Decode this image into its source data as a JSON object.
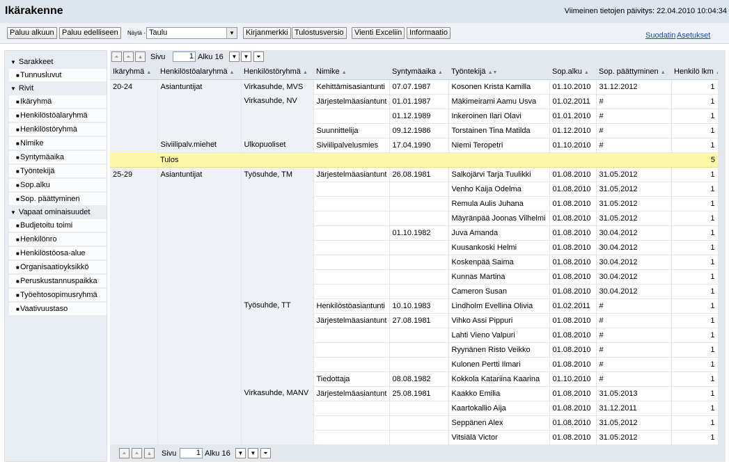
{
  "header": {
    "title": "Ikärakenne",
    "last_update": "Viimeinen tietojen päivitys: 22.04.2010 10:04:34"
  },
  "toolbar": {
    "back_home": "Paluu alkuun",
    "back_prev": "Paluu edelliseen",
    "view_label": "Näytä -",
    "view_value": "Taulu",
    "bookmark": "Kirjanmerkki",
    "print": "Tulostusversio",
    "excel": "Vienti Exceliin",
    "info": "Informaatio",
    "filter": "Suodatin",
    "settings": "Asetukset"
  },
  "sidebar": {
    "sections": [
      {
        "title": "Sarakkeet",
        "items": [
          "Tunnusluvut"
        ]
      },
      {
        "title": "Rivit",
        "items": [
          "Ikäryhmä",
          "Henkilöstöalaryhmä",
          "Henkilöstöryhmä",
          "Nimike",
          "Syntymäaika",
          "Työntekijä",
          "Sop.alku",
          "Sop. päättyminen"
        ]
      },
      {
        "title": "Vapaat ominaisuudet",
        "items": [
          "Budjetoitu toimi",
          "Henkilönro",
          "Henkilöstöosa-alue",
          "Organisaatioyksikkö",
          "Peruskustannuspaikka",
          "Työehtosopimusryhmä",
          "Vaativuustaso"
        ]
      }
    ]
  },
  "pager": {
    "page_label": "Sivu",
    "page_value": "1",
    "start_label": "Alku 16"
  },
  "table": {
    "columns": [
      "Ikäryhmä",
      "Henkilöstöalaryhmä",
      "Henkilöstöryhmä",
      "Nimike",
      "Syntymäaika",
      "Työntekijä",
      "Sop.alku",
      "Sop. päättyminen",
      "Henkilö lkm"
    ],
    "total_label": "Tulos",
    "total_value": "5",
    "rows": [
      [
        "20-24",
        "Asiantuntijat",
        "Virkasuhde, MVS",
        "Kehittämisasiantunti",
        "07.07.1987",
        "Kosonen Krista Kamilla",
        "01.10.2010",
        "31.12.2012",
        "1"
      ],
      [
        "",
        "",
        "Virkasuhde, NV",
        "Järjestelmäasiantunt",
        "01.01.1987",
        "Mäkimeirami Aamu Usva",
        "01.02.2011",
        "#",
        "1"
      ],
      [
        "",
        "",
        "",
        "",
        "01.12.1989",
        "Inkeroinen Ilari Olavi",
        "01.01.2010",
        "#",
        "1"
      ],
      [
        "",
        "",
        "",
        "Suunnittelija",
        "09.12.1986",
        "Torstainen Tina Matilda",
        "01.12.2010",
        "#",
        "1"
      ],
      [
        "",
        "Siviilipalv.miehet",
        "Ulkopuoliset",
        "Siviilipalvelusmies",
        "17.04.1990",
        "Niemi Teropetri",
        "01.10.2010",
        "#",
        "1"
      ],
      [
        "25-29",
        "Asiantuntijat",
        "Työsuhde, TM",
        "Järjestelmäasiantunt",
        "26.08.1981",
        "Salkojärvi Tarja Tuulikki",
        "01.08.2010",
        "31.05.2012",
        "1"
      ],
      [
        "",
        "",
        "",
        "",
        "",
        "Venho Kaija Odelma",
        "01.08.2010",
        "31.05.2012",
        "1"
      ],
      [
        "",
        "",
        "",
        "",
        "",
        "Remula Aulis Juhana",
        "01.08.2010",
        "31.05.2012",
        "1"
      ],
      [
        "",
        "",
        "",
        "",
        "",
        "Mäyränpää Joonas Vilhelmi",
        "01.08.2010",
        "31.05.2012",
        "1"
      ],
      [
        "",
        "",
        "",
        "",
        "01.10.1982",
        "Juva Amanda",
        "01.08.2010",
        "30.04.2012",
        "1"
      ],
      [
        "",
        "",
        "",
        "",
        "",
        "Kuusankoski Helmi",
        "01.08.2010",
        "30.04.2012",
        "1"
      ],
      [
        "",
        "",
        "",
        "",
        "",
        "Koskenpää Saima",
        "01.08.2010",
        "30.04.2012",
        "1"
      ],
      [
        "",
        "",
        "",
        "",
        "",
        "Kunnas Martina",
        "01.08.2010",
        "30.04.2012",
        "1"
      ],
      [
        "",
        "",
        "",
        "",
        "",
        "Cameron Susan",
        "01.08.2010",
        "30.04.2012",
        "1"
      ],
      [
        "",
        "",
        "Työsuhde, TT",
        "Henkilöstöasiantunti",
        "10.10.1983",
        "Lindholm Evellina Olivia",
        "01.02.2011",
        "#",
        "1"
      ],
      [
        "",
        "",
        "",
        "Järjestelmäasiantunt",
        "27.08.1981",
        "Vihko Assi Pippuri",
        "01.08.2010",
        "#",
        "1"
      ],
      [
        "",
        "",
        "",
        "",
        "",
        "Lahti Vieno Valpuri",
        "01.08.2010",
        "#",
        "1"
      ],
      [
        "",
        "",
        "",
        "",
        "",
        "Ryynänen Risto Veikko",
        "01.08.2010",
        "#",
        "1"
      ],
      [
        "",
        "",
        "",
        "",
        "",
        "Kulonen Pertti Ilmari",
        "01.08.2010",
        "#",
        "1"
      ],
      [
        "",
        "",
        "",
        "Tiedottaja",
        "08.08.1982",
        "Kokkola Katariina Kaarina",
        "01.10.2010",
        "#",
        "1"
      ],
      [
        "",
        "",
        "Virkasuhde, MANV",
        "Järjestelmäasiantunt",
        "25.08.1981",
        "Kaakko Emilia",
        "01.08.2010",
        "31.05.2013",
        "1"
      ],
      [
        "",
        "",
        "",
        "",
        "",
        "Kaartokallio Aija",
        "01.08.2010",
        "31.12.2011",
        "1"
      ],
      [
        "",
        "",
        "",
        "",
        "",
        "Seppänen Alex",
        "01.08.2010",
        "31.05.2012",
        "1"
      ],
      [
        "",
        "",
        "",
        "",
        "",
        "Vitsiälä Victor",
        "01.08.2010",
        "31.05.2012",
        "1"
      ]
    ]
  }
}
